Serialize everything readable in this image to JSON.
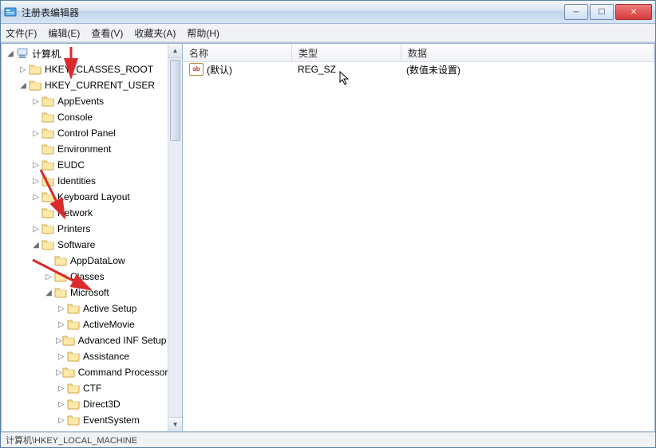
{
  "window": {
    "title": "注册表编辑器"
  },
  "menu": {
    "file": "文件(F)",
    "edit": "编辑(E)",
    "view": "查看(V)",
    "favorites": "收藏夹(A)",
    "help": "帮助(H)"
  },
  "tree": {
    "root": "计算机",
    "hkcr": "HKEY_CLASSES_ROOT",
    "hkcu": "HKEY_CURRENT_USER",
    "appevents": "AppEvents",
    "console": "Console",
    "controlpanel": "Control Panel",
    "environment": "Environment",
    "eudc": "EUDC",
    "identities": "Identities",
    "keyboard": "Keyboard Layout",
    "network": "Network",
    "printers": "Printers",
    "software": "Software",
    "appdatalow": "AppDataLow",
    "classes": "Classes",
    "microsoft": "Microsoft",
    "activesetup": "Active Setup",
    "activemovie": "ActiveMovie",
    "advinf": "Advanced INF Setup",
    "assistance": "Assistance",
    "cmdproc": "Command Processor",
    "ctf": "CTF",
    "direct3d": "Direct3D",
    "eventsystem": "EventSystem"
  },
  "list": {
    "headers": {
      "name": "名称",
      "type": "类型",
      "data": "数据"
    },
    "rows": [
      {
        "name": "(默认)",
        "type": "REG_SZ",
        "data": "(数值未设置)"
      }
    ]
  },
  "status": {
    "path": "计算机\\HKEY_LOCAL_MACHINE"
  },
  "winbtn": {
    "min": "─",
    "max": "☐",
    "close": "✕"
  }
}
